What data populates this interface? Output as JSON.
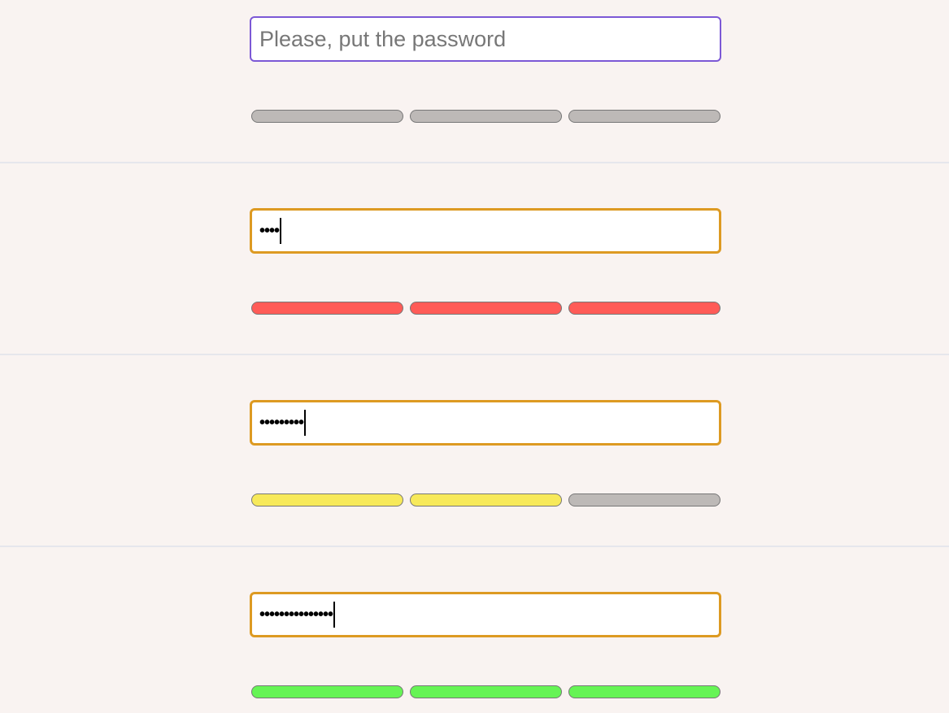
{
  "placeholder": "Please, put the password",
  "colors": {
    "empty": "#bdb9b7",
    "weak": "#ff5b57",
    "medium": "#f7e95a",
    "strong": "#66f455"
  },
  "panels": [
    {
      "value": "",
      "masked": "",
      "strength_segments": 0,
      "bar_color": "empty"
    },
    {
      "value": "",
      "masked": "••••",
      "strength_segments": 3,
      "bar_color": "weak"
    },
    {
      "value": "",
      "masked": "•••••••••",
      "strength_segments": 2,
      "bar_color": "medium"
    },
    {
      "value": "",
      "masked": "•••••••••••••••",
      "strength_segments": 3,
      "bar_color": "strong"
    }
  ]
}
